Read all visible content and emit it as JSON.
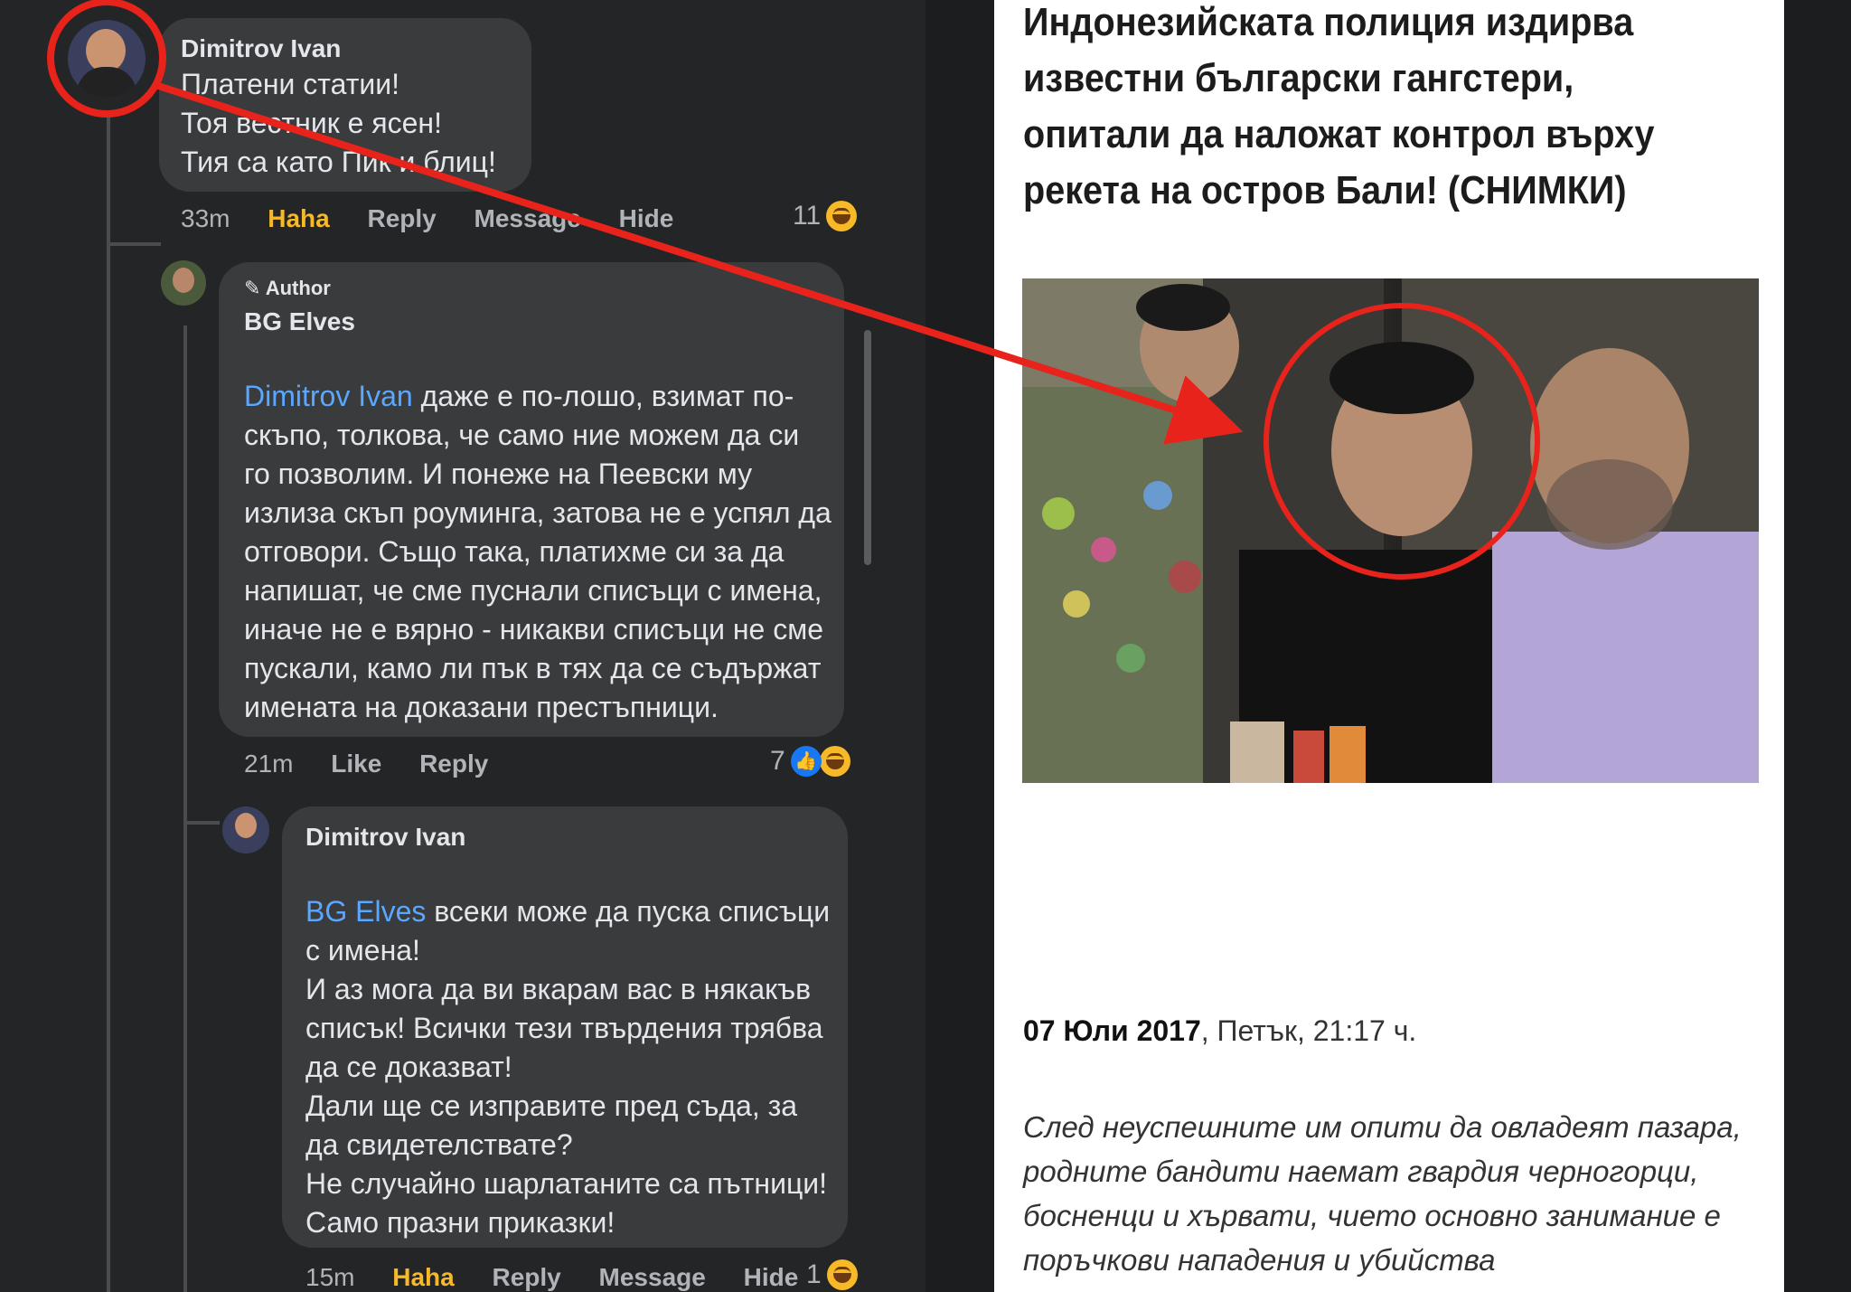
{
  "comments": [
    {
      "author": "Dimitrov Ivan",
      "lines": "Платени статии!\nТоя вестник е ясен!\nТия са като Пик и блиц!",
      "time": "33m",
      "actions": [
        "Haha",
        "Reply",
        "Message",
        "Hide"
      ],
      "reaction_count": "11"
    },
    {
      "badge": "Author",
      "author": "BG Elves",
      "mention": "Dimitrov Ivan",
      "body": " даже е по-лошо, взимат по-скъпо, толкова, че само ние можем да си го позволим. И понеже на Пеевски му излиза скъп роуминга, затова не е успял да отговори. Също така, платихме си за да напишат, че сме пуснали списъци с имена, иначе не е вярно - никакви списъци не сме пускали, камо ли пък в тях да се съдържат имената на доказани престъпници.",
      "time": "21m",
      "actions": [
        "Like",
        "Reply"
      ],
      "reaction_count": "7"
    },
    {
      "author": "Dimitrov Ivan",
      "mention": "BG Elves",
      "body": " всеки може да пуска списъци с имена!\nИ аз мога да ви вкарам вас в някакъв списък! Всички тези твърдения трябва да се доказват!\nДали ще се изправите пред съда, за да свидетелствате?\nНе случайно шарлатаните са пътници!\nСамо празни приказки!",
      "time": "15m",
      "actions": [
        "Haha",
        "Reply",
        "Message",
        "Hide"
      ],
      "reaction_count": "1"
    }
  ],
  "article": {
    "headline": "Индонезийската полиция издирва известни български гангстери, опитали да наложат контрол върху рекета на остров Бали! (СНИМКИ)",
    "date_bold": "07 Юли 2017",
    "date_rest": ", Петък, 21:17 ч.",
    "lede": "След неуспешните им опити да овладеят пазара,\nродните бандити наемат гвардия черногорци,\nбосненци и хървати, чието основно занимание е\nпоръчкови нападения и убийства"
  },
  "colors": {
    "dark_bg": "#242526",
    "bubble": "#3a3b3c",
    "haha": "#f7b928",
    "mention": "#5aa7ff",
    "annotation_red": "#e8231b"
  }
}
